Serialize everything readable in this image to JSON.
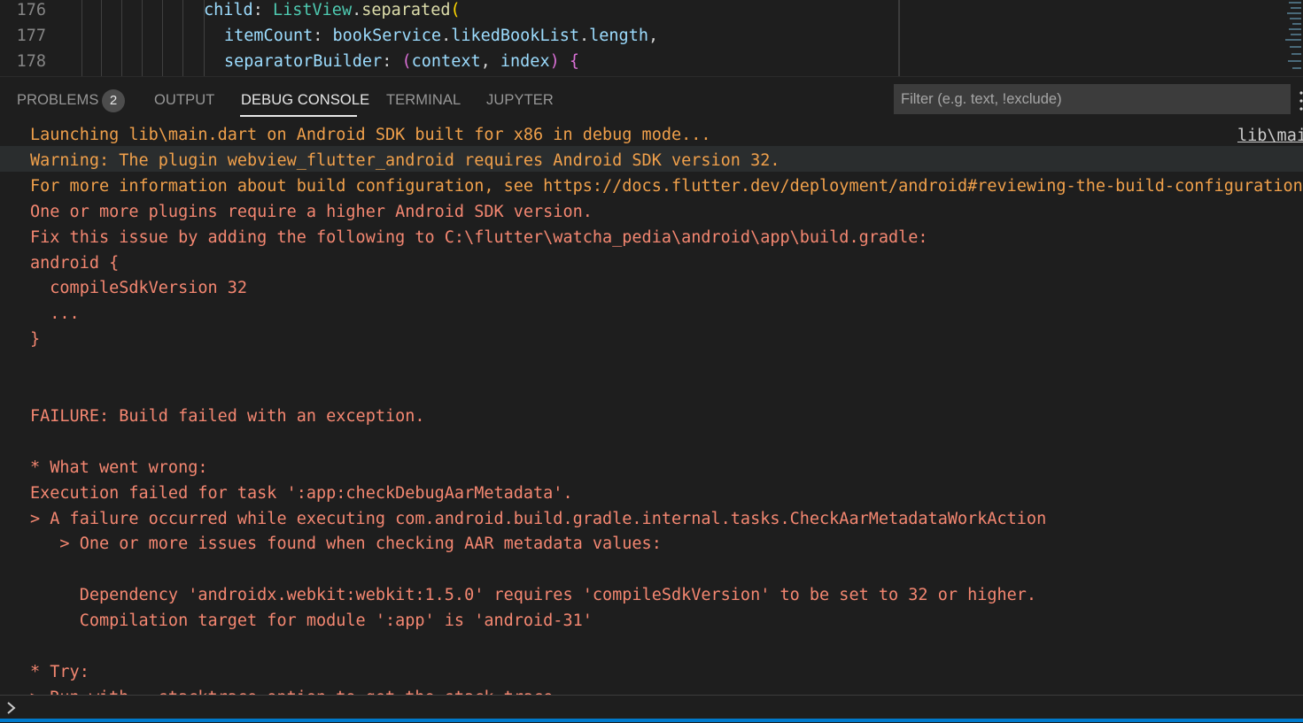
{
  "editor": {
    "lines": [
      {
        "number": "176",
        "tokens": [
          [
            "t-var",
            "child"
          ],
          [
            "t-w",
            ": "
          ],
          [
            "t-cls",
            "ListView"
          ],
          [
            "t-w",
            "."
          ],
          [
            "t-fn",
            "separated"
          ],
          [
            "t-p1",
            "("
          ]
        ]
      },
      {
        "number": "177",
        "tokens": [
          [
            "t-var",
            "itemCount"
          ],
          [
            "t-w",
            ": "
          ],
          [
            "t-var",
            "bookService"
          ],
          [
            "t-w",
            "."
          ],
          [
            "t-var",
            "likedBookList"
          ],
          [
            "t-w",
            "."
          ],
          [
            "t-var",
            "length"
          ],
          [
            "t-w",
            ","
          ]
        ]
      },
      {
        "number": "178",
        "tokens": [
          [
            "t-var",
            "separatorBuilder"
          ],
          [
            "t-w",
            ": "
          ],
          [
            "t-p2",
            "("
          ],
          [
            "t-var",
            "context"
          ],
          [
            "t-w",
            ", "
          ],
          [
            "t-var",
            "index"
          ],
          [
            "t-p2",
            ")"
          ],
          [
            "t-w",
            " "
          ],
          [
            "t-p2",
            "{"
          ]
        ]
      }
    ]
  },
  "panel": {
    "tabs": [
      {
        "label": "PROBLEMS",
        "active": false
      },
      {
        "label": "OUTPUT",
        "active": false
      },
      {
        "label": "DEBUG CONSOLE",
        "active": true
      },
      {
        "label": "TERMINAL",
        "active": false
      },
      {
        "label": "JUPYTER",
        "active": false
      }
    ],
    "problems_count": "2",
    "filter_placeholder": "Filter (e.g. text, !exclude)"
  },
  "console": {
    "source_link": "lib\\main",
    "lines": [
      {
        "text": "Launching lib\\main.dart on Android SDK built for x86 in debug mode...",
        "color": "orange"
      },
      {
        "text": "Warning: The plugin webview_flutter_android requires Android SDK version 32.",
        "color": "orange"
      },
      {
        "text": "For more information about build configuration, see https://docs.flutter.dev/deployment/android#reviewing-the-build-configuration",
        "color": "orange"
      },
      {
        "text": "One or more plugins require a higher Android SDK version.",
        "color": "red"
      },
      {
        "text": "Fix this issue by adding the following to C:\\flutter\\watcha_pedia\\android\\app\\build.gradle:",
        "color": "red"
      },
      {
        "text": "android {",
        "color": "red"
      },
      {
        "text": "  compileSdkVersion 32",
        "color": "red"
      },
      {
        "text": "  ...",
        "color": "red"
      },
      {
        "text": "}",
        "color": "red"
      },
      {
        "text": "",
        "color": "red"
      },
      {
        "text": "",
        "color": "red"
      },
      {
        "text": "FAILURE: Build failed with an exception.",
        "color": "red"
      },
      {
        "text": "",
        "color": "red"
      },
      {
        "text": "* What went wrong:",
        "color": "red"
      },
      {
        "text": "Execution failed for task ':app:checkDebugAarMetadata'.",
        "color": "red"
      },
      {
        "text": "> A failure occurred while executing com.android.build.gradle.internal.tasks.CheckAarMetadataWorkAction",
        "color": "red"
      },
      {
        "text": "   > One or more issues found when checking AAR metadata values:",
        "color": "red"
      },
      {
        "text": "",
        "color": "red"
      },
      {
        "text": "     Dependency 'androidx.webkit:webkit:1.5.0' requires 'compileSdkVersion' to be set to 32 or higher.",
        "color": "red"
      },
      {
        "text": "     Compilation target for module ':app' is 'android-31'",
        "color": "red"
      },
      {
        "text": "",
        "color": "red"
      },
      {
        "text": "* Try:",
        "color": "red"
      },
      {
        "text": "> Run with --stacktrace option to get the stack trace.",
        "color": "red"
      }
    ]
  },
  "colors": {
    "background": "#1e1e1e",
    "console_orange": "#f0a04b",
    "console_red": "#f48771",
    "accent": "#007acc"
  }
}
